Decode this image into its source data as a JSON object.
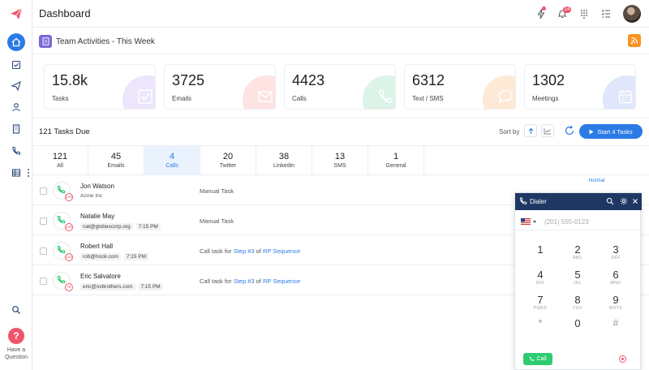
{
  "header": {
    "title": "Dashboard",
    "notification_count": "24"
  },
  "sidebar": {
    "icons": [
      "logo-icon",
      "home-icon",
      "tasks-icon",
      "send-icon",
      "contacts-icon",
      "company-icon",
      "phone-icon",
      "table-icon",
      "search-icon"
    ],
    "help_label": "Have a Question"
  },
  "section": {
    "title": "Team Activities - This Week"
  },
  "stats": [
    {
      "value": "15.8k",
      "label": "Tasks",
      "color": "#e8e0fb"
    },
    {
      "value": "3725",
      "label": "Emails",
      "color": "#fde2e0"
    },
    {
      "value": "4423",
      "label": "Calls",
      "color": "#ddf3e8"
    },
    {
      "value": "6312",
      "label": "Text / SMS",
      "color": "#fde8d4"
    },
    {
      "value": "1302",
      "label": "Meetings",
      "color": "#e0e6fb"
    }
  ],
  "toolbar": {
    "tasks_due": "121 Tasks Due",
    "sort_label": "Sort by",
    "start_label": "Start 4 Tasks"
  },
  "tabs": [
    {
      "count": "121",
      "label": "All"
    },
    {
      "count": "45",
      "label": "Emails"
    },
    {
      "count": "4",
      "label": "Calls"
    },
    {
      "count": "20",
      "label": "Twitter"
    },
    {
      "count": "38",
      "label": "Linkedin"
    },
    {
      "count": "13",
      "label": "SMS"
    },
    {
      "count": "1",
      "label": "General"
    }
  ],
  "rows": [
    {
      "name": "Jon Watson",
      "company": "Acme Inc",
      "email": "",
      "time": "",
      "num": "144",
      "task": "Manual Task",
      "task_link1": "",
      "task_mid": "",
      "task_link2": "",
      "priority": "Normal"
    },
    {
      "name": "Natalie May",
      "company": "",
      "email": "nat@globexcorp.org",
      "time": "7:15 PM",
      "num": "142",
      "task": "Manual Task",
      "task_link1": "",
      "task_mid": "",
      "task_link2": "",
      "priority": ""
    },
    {
      "name": "Robert Hall",
      "company": "",
      "email": "rob@hooli.com",
      "time": "7:15 PM",
      "num": "144",
      "task": "Call task for ",
      "task_link1": "Step #3",
      "task_mid": " of ",
      "task_link2": "RP Sequence",
      "priority": ""
    },
    {
      "name": "Eric Salvatore",
      "company": "",
      "email": "eric@svbrothers.com",
      "time": "7:15 PM",
      "num": "78",
      "task": "Call task for ",
      "task_link1": "Step #3",
      "task_mid": " of ",
      "task_link2": "RP Sequence",
      "priority": ""
    }
  ],
  "dialer": {
    "title": "Dialer",
    "placeholder": "(201) 555-0123",
    "keys": [
      {
        "num": "1",
        "letters": ""
      },
      {
        "num": "2",
        "letters": "ABC"
      },
      {
        "num": "3",
        "letters": "DEF"
      },
      {
        "num": "4",
        "letters": "GHI"
      },
      {
        "num": "5",
        "letters": "JKL"
      },
      {
        "num": "6",
        "letters": "MNO"
      },
      {
        "num": "7",
        "letters": "PQRS"
      },
      {
        "num": "8",
        "letters": "TUV"
      },
      {
        "num": "9",
        "letters": "WXYZ"
      },
      {
        "num": "*",
        "letters": ""
      },
      {
        "num": "0",
        "letters": ""
      },
      {
        "num": "#",
        "letters": ""
      }
    ],
    "call_label": "Call"
  },
  "colors": {
    "accent": "#2b7be5",
    "danger": "#f0546c",
    "dialer_header": "#1f3763",
    "call_green": "#2ecc71"
  }
}
